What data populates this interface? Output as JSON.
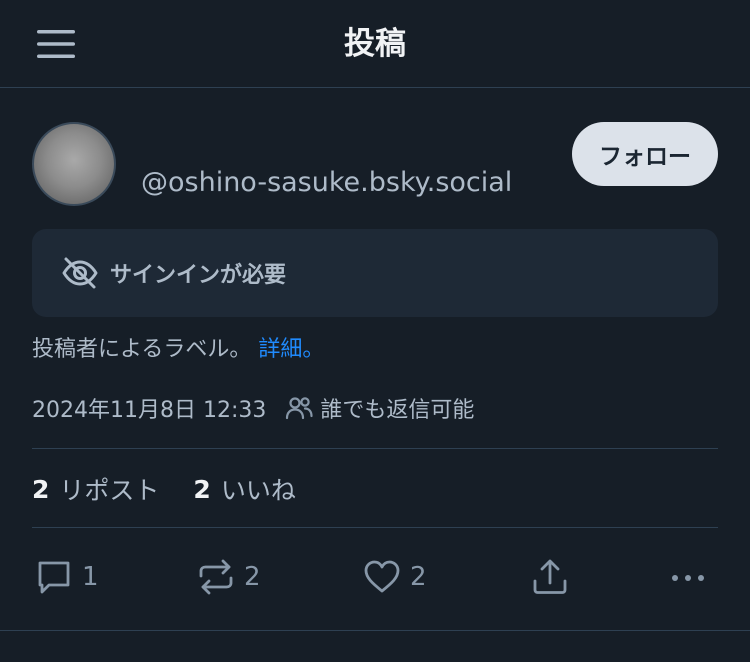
{
  "header": {
    "title": "投稿",
    "menu_icon": "hamburger-menu-icon"
  },
  "author": {
    "handle": "@oshino-sasuke.bsky.social",
    "follow_label": "フォロー"
  },
  "content_warning": {
    "icon": "eye-slash-icon",
    "label": "サインインが必要"
  },
  "label_note": {
    "text": "投稿者によるラベル。",
    "link": "詳細。"
  },
  "meta": {
    "timestamp": "2024年11月8日 12:33",
    "reply_icon": "people-icon",
    "reply_setting": "誰でも返信可能"
  },
  "stats": {
    "reposts_count": "2",
    "reposts_label": "リポスト",
    "likes_count": "2",
    "likes_label": "いいね"
  },
  "actions": {
    "reply_count": "1",
    "repost_count": "2",
    "like_count": "2"
  },
  "colors": {
    "background": "#161e27",
    "accent_link": "#208bfe",
    "muted_text": "#aebbc9",
    "follow_button_bg": "#dce2ea"
  }
}
